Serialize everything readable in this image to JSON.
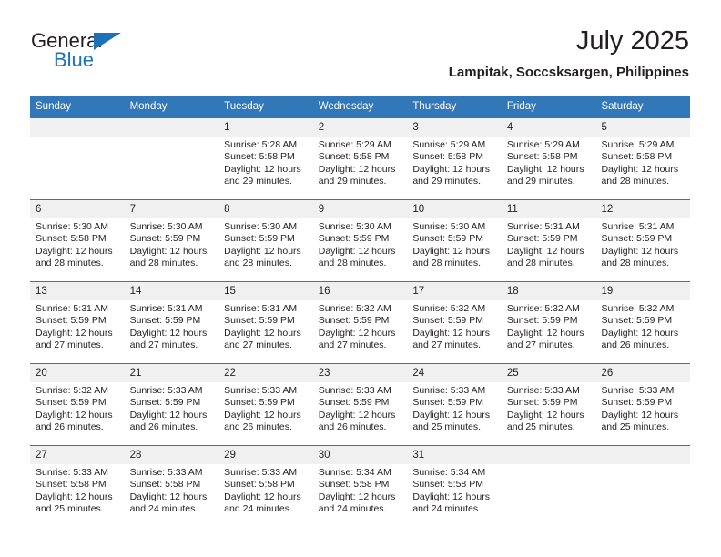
{
  "brand": {
    "name_part1": "General",
    "name_part2": "Blue",
    "triangle_color": "#1b72b8"
  },
  "header": {
    "title": "July 2025",
    "subtitle": "Lampitak, Soccsksargen, Philippines"
  },
  "theme": {
    "header_blue": "#3277b8",
    "number_band": "#f0f0f0",
    "text": "#231f20"
  },
  "weekday_headers": [
    "Sunday",
    "Monday",
    "Tuesday",
    "Wednesday",
    "Thursday",
    "Friday",
    "Saturday"
  ],
  "weeks": [
    {
      "numbers": [
        "",
        "",
        "1",
        "2",
        "3",
        "4",
        "5"
      ],
      "days": [
        {
          "sunrise": "",
          "sunset": "",
          "daylight1": "",
          "daylight2": ""
        },
        {
          "sunrise": "",
          "sunset": "",
          "daylight1": "",
          "daylight2": ""
        },
        {
          "sunrise": "Sunrise: 5:28 AM",
          "sunset": "Sunset: 5:58 PM",
          "daylight1": "Daylight: 12 hours",
          "daylight2": "and 29 minutes."
        },
        {
          "sunrise": "Sunrise: 5:29 AM",
          "sunset": "Sunset: 5:58 PM",
          "daylight1": "Daylight: 12 hours",
          "daylight2": "and 29 minutes."
        },
        {
          "sunrise": "Sunrise: 5:29 AM",
          "sunset": "Sunset: 5:58 PM",
          "daylight1": "Daylight: 12 hours",
          "daylight2": "and 29 minutes."
        },
        {
          "sunrise": "Sunrise: 5:29 AM",
          "sunset": "Sunset: 5:58 PM",
          "daylight1": "Daylight: 12 hours",
          "daylight2": "and 29 minutes."
        },
        {
          "sunrise": "Sunrise: 5:29 AM",
          "sunset": "Sunset: 5:58 PM",
          "daylight1": "Daylight: 12 hours",
          "daylight2": "and 28 minutes."
        }
      ]
    },
    {
      "numbers": [
        "6",
        "7",
        "8",
        "9",
        "10",
        "11",
        "12"
      ],
      "days": [
        {
          "sunrise": "Sunrise: 5:30 AM",
          "sunset": "Sunset: 5:58 PM",
          "daylight1": "Daylight: 12 hours",
          "daylight2": "and 28 minutes."
        },
        {
          "sunrise": "Sunrise: 5:30 AM",
          "sunset": "Sunset: 5:59 PM",
          "daylight1": "Daylight: 12 hours",
          "daylight2": "and 28 minutes."
        },
        {
          "sunrise": "Sunrise: 5:30 AM",
          "sunset": "Sunset: 5:59 PM",
          "daylight1": "Daylight: 12 hours",
          "daylight2": "and 28 minutes."
        },
        {
          "sunrise": "Sunrise: 5:30 AM",
          "sunset": "Sunset: 5:59 PM",
          "daylight1": "Daylight: 12 hours",
          "daylight2": "and 28 minutes."
        },
        {
          "sunrise": "Sunrise: 5:30 AM",
          "sunset": "Sunset: 5:59 PM",
          "daylight1": "Daylight: 12 hours",
          "daylight2": "and 28 minutes."
        },
        {
          "sunrise": "Sunrise: 5:31 AM",
          "sunset": "Sunset: 5:59 PM",
          "daylight1": "Daylight: 12 hours",
          "daylight2": "and 28 minutes."
        },
        {
          "sunrise": "Sunrise: 5:31 AM",
          "sunset": "Sunset: 5:59 PM",
          "daylight1": "Daylight: 12 hours",
          "daylight2": "and 28 minutes."
        }
      ]
    },
    {
      "numbers": [
        "13",
        "14",
        "15",
        "16",
        "17",
        "18",
        "19"
      ],
      "days": [
        {
          "sunrise": "Sunrise: 5:31 AM",
          "sunset": "Sunset: 5:59 PM",
          "daylight1": "Daylight: 12 hours",
          "daylight2": "and 27 minutes."
        },
        {
          "sunrise": "Sunrise: 5:31 AM",
          "sunset": "Sunset: 5:59 PM",
          "daylight1": "Daylight: 12 hours",
          "daylight2": "and 27 minutes."
        },
        {
          "sunrise": "Sunrise: 5:31 AM",
          "sunset": "Sunset: 5:59 PM",
          "daylight1": "Daylight: 12 hours",
          "daylight2": "and 27 minutes."
        },
        {
          "sunrise": "Sunrise: 5:32 AM",
          "sunset": "Sunset: 5:59 PM",
          "daylight1": "Daylight: 12 hours",
          "daylight2": "and 27 minutes."
        },
        {
          "sunrise": "Sunrise: 5:32 AM",
          "sunset": "Sunset: 5:59 PM",
          "daylight1": "Daylight: 12 hours",
          "daylight2": "and 27 minutes."
        },
        {
          "sunrise": "Sunrise: 5:32 AM",
          "sunset": "Sunset: 5:59 PM",
          "daylight1": "Daylight: 12 hours",
          "daylight2": "and 27 minutes."
        },
        {
          "sunrise": "Sunrise: 5:32 AM",
          "sunset": "Sunset: 5:59 PM",
          "daylight1": "Daylight: 12 hours",
          "daylight2": "and 26 minutes."
        }
      ]
    },
    {
      "numbers": [
        "20",
        "21",
        "22",
        "23",
        "24",
        "25",
        "26"
      ],
      "days": [
        {
          "sunrise": "Sunrise: 5:32 AM",
          "sunset": "Sunset: 5:59 PM",
          "daylight1": "Daylight: 12 hours",
          "daylight2": "and 26 minutes."
        },
        {
          "sunrise": "Sunrise: 5:33 AM",
          "sunset": "Sunset: 5:59 PM",
          "daylight1": "Daylight: 12 hours",
          "daylight2": "and 26 minutes."
        },
        {
          "sunrise": "Sunrise: 5:33 AM",
          "sunset": "Sunset: 5:59 PM",
          "daylight1": "Daylight: 12 hours",
          "daylight2": "and 26 minutes."
        },
        {
          "sunrise": "Sunrise: 5:33 AM",
          "sunset": "Sunset: 5:59 PM",
          "daylight1": "Daylight: 12 hours",
          "daylight2": "and 26 minutes."
        },
        {
          "sunrise": "Sunrise: 5:33 AM",
          "sunset": "Sunset: 5:59 PM",
          "daylight1": "Daylight: 12 hours",
          "daylight2": "and 25 minutes."
        },
        {
          "sunrise": "Sunrise: 5:33 AM",
          "sunset": "Sunset: 5:59 PM",
          "daylight1": "Daylight: 12 hours",
          "daylight2": "and 25 minutes."
        },
        {
          "sunrise": "Sunrise: 5:33 AM",
          "sunset": "Sunset: 5:59 PM",
          "daylight1": "Daylight: 12 hours",
          "daylight2": "and 25 minutes."
        }
      ]
    },
    {
      "numbers": [
        "27",
        "28",
        "29",
        "30",
        "31",
        "",
        ""
      ],
      "days": [
        {
          "sunrise": "Sunrise: 5:33 AM",
          "sunset": "Sunset: 5:58 PM",
          "daylight1": "Daylight: 12 hours",
          "daylight2": "and 25 minutes."
        },
        {
          "sunrise": "Sunrise: 5:33 AM",
          "sunset": "Sunset: 5:58 PM",
          "daylight1": "Daylight: 12 hours",
          "daylight2": "and 24 minutes."
        },
        {
          "sunrise": "Sunrise: 5:33 AM",
          "sunset": "Sunset: 5:58 PM",
          "daylight1": "Daylight: 12 hours",
          "daylight2": "and 24 minutes."
        },
        {
          "sunrise": "Sunrise: 5:34 AM",
          "sunset": "Sunset: 5:58 PM",
          "daylight1": "Daylight: 12 hours",
          "daylight2": "and 24 minutes."
        },
        {
          "sunrise": "Sunrise: 5:34 AM",
          "sunset": "Sunset: 5:58 PM",
          "daylight1": "Daylight: 12 hours",
          "daylight2": "and 24 minutes."
        },
        {
          "sunrise": "",
          "sunset": "",
          "daylight1": "",
          "daylight2": ""
        },
        {
          "sunrise": "",
          "sunset": "",
          "daylight1": "",
          "daylight2": ""
        }
      ]
    }
  ]
}
